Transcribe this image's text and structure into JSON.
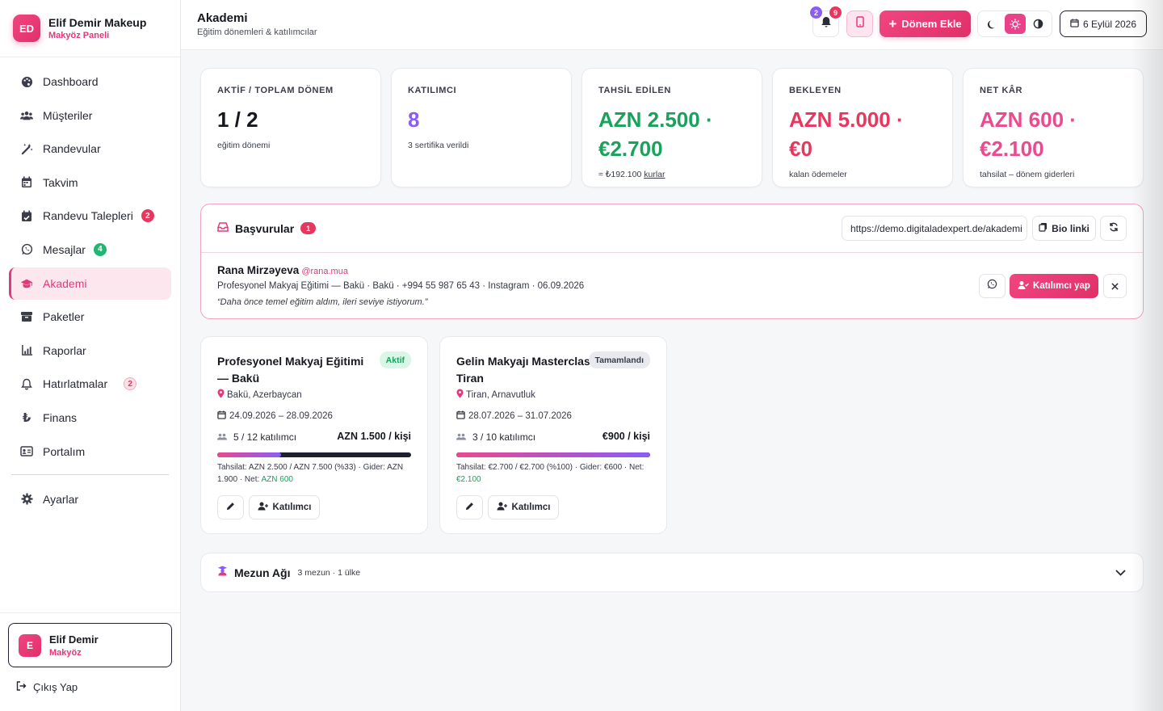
{
  "brand": {
    "initials": "ED",
    "name": "Elif Demir Makeup",
    "subtitle": "Makyöz Paneli"
  },
  "sidebar": {
    "items": [
      {
        "label": "Dashboard",
        "icon": "palette-icon"
      },
      {
        "label": "Müşteriler",
        "icon": "users-icon"
      },
      {
        "label": "Randevular",
        "icon": "magic-wand-icon"
      },
      {
        "label": "Takvim",
        "icon": "calendar-icon"
      },
      {
        "label": "Randevu Talepleri",
        "icon": "calendar-check-icon",
        "badge": "2"
      },
      {
        "label": "Mesajlar",
        "icon": "whatsapp-icon",
        "badge": "4"
      },
      {
        "label": "Akademi",
        "icon": "graduation-cap-icon",
        "active": true
      },
      {
        "label": "Paketler",
        "icon": "box-icon"
      },
      {
        "label": "Raporlar",
        "icon": "chart-icon"
      },
      {
        "label": "Hatırlatmalar",
        "icon": "bell-icon",
        "badge": "2"
      },
      {
        "label": "Finans",
        "icon": "lira-icon"
      },
      {
        "label": "Portalım",
        "icon": "id-card-icon"
      }
    ],
    "settings": "Ayarlar",
    "user": {
      "initial": "E",
      "name": "Elif Demir",
      "role": "Makyöz"
    },
    "logout": "Çıkış Yap"
  },
  "header": {
    "title": "Akademi",
    "subtitle": "Eğitim dönemleri & katılımcılar",
    "bell_badge_purple": "2",
    "bell_badge_red": "9",
    "add_button": "Dönem Ekle",
    "date": "6 Eylül 2026",
    "accent_color": "#E8397A"
  },
  "stats": [
    {
      "label": "AKTİF / TOPLAM DÖNEM",
      "value": "1 / 2",
      "note": "eğitim dönemi",
      "color": "#16181F"
    },
    {
      "label": "KATILIMCI",
      "value": "8",
      "note": "3 sertifika verildi",
      "color": "#8B5CF6"
    },
    {
      "label": "TAHSİL EDİLEN",
      "value_line1": "AZN 2.500 ·",
      "value_line2": "€2.700",
      "note": "≈ ₺192.100",
      "note_link": "kurlar",
      "color": "#19A25B"
    },
    {
      "label": "BEKLEYEN",
      "value_line1": "AZN 5.000 ·",
      "value_line2": "€0",
      "note": "kalan ödemeler",
      "color": "#E8365F"
    },
    {
      "label": "NET KÂR",
      "value_line1": "AZN 600 ·",
      "value_line2": "€2.100",
      "note": "tahsilat – dönem giderleri",
      "color": "#EC4A8F"
    }
  ],
  "applications": {
    "title": "Başvurular",
    "count": "1",
    "url": "https://demo.digitaladexpert.de/akademi",
    "bio_button": "Bio linki",
    "item": {
      "name": "Rana Mirzəyeva",
      "handle": "@rana.mua",
      "details": "Profesyonel Makyaj Eğitimi — Bakü · Bakü · +994 55 987 65 43 · Instagram · 06.09.2026",
      "quote": "“Daha önce temel eğitim aldım, ileri seviye istiyorum.”",
      "action": "Katılımcı yap"
    }
  },
  "programs": [
    {
      "title": "Profesyonel Makyaj Eğitimi — Bakü",
      "status": "Aktif",
      "location": "Bakü, Azerbaycan",
      "dates": "24.09.2026 – 28.09.2026",
      "participants": "5 / 12 katılımcı",
      "price": "AZN 1.500 / kişi",
      "fill_percent": 33,
      "footer": "Tahsilat: AZN 2.500 / AZN 7.500 (%33) · Gider: AZN 1.900 · Net:",
      "net": "AZN 600",
      "add_label": "Katılımcı"
    },
    {
      "title": "Gelin Makyajı Masterclass — Tiran",
      "status": "Tamamlandı",
      "location": "Tiran, Arnavutluk",
      "dates": "28.07.2026 – 31.07.2026",
      "participants": "3 / 10 katılımcı",
      "price": "€900 / kişi",
      "fill_percent": 100,
      "footer": "Tahsilat: €2.700 / €2.700 (%100) · Gider: €600 · Net:",
      "net": "€2.100",
      "add_label": "Katılımcı"
    }
  ],
  "alumni": {
    "title": "Mezun Ağı",
    "meta": "3 mezun · 1 ülke"
  }
}
